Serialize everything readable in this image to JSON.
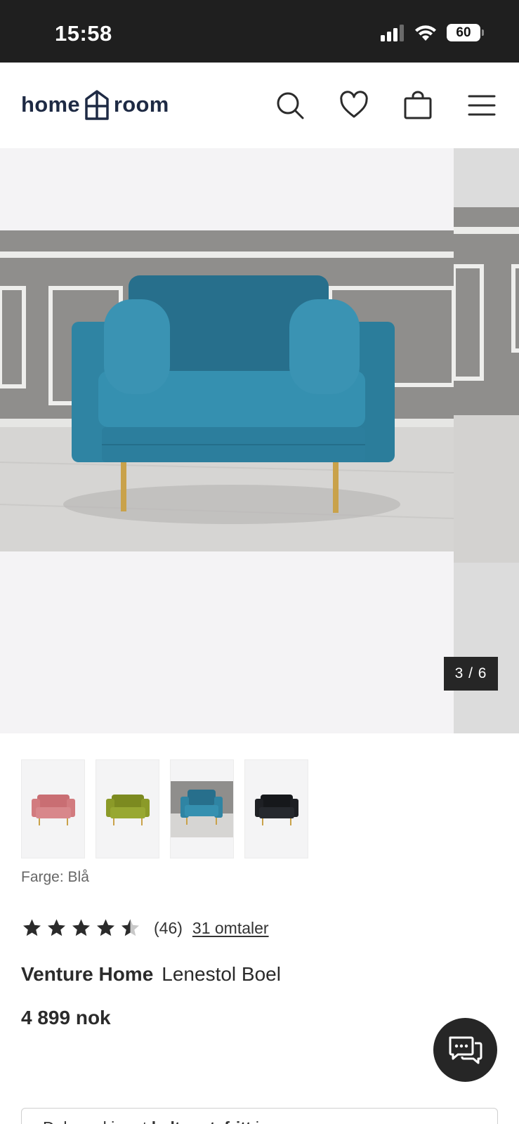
{
  "status_bar": {
    "time": "15:58",
    "battery": "60",
    "icons": [
      "signal-icon",
      "wifi-icon",
      "battery-icon"
    ]
  },
  "header": {
    "logo_left": "home",
    "logo_right": "room",
    "icons": [
      "search-icon",
      "heart-icon",
      "bag-icon",
      "menu-icon"
    ]
  },
  "gallery": {
    "counter": "3 / 6",
    "colors": {
      "chair": "#2f84a3",
      "wall": "#8c8c8a",
      "floor": "#d7d6d4",
      "legs": "#c9a24a"
    }
  },
  "thumbnails": [
    {
      "color": "#d27b7f",
      "icon": "armchair-pink"
    },
    {
      "color": "#8b9a28",
      "icon": "armchair-green"
    },
    {
      "color": "#2f84a3",
      "icon": "armchair-blue",
      "selected": true
    },
    {
      "color": "#1e2024",
      "icon": "armchair-black"
    }
  ],
  "color_label": "Farge: Blå",
  "rating": {
    "value": 4.5,
    "count": "(46)",
    "reviews_link": "31 omtaler"
  },
  "product": {
    "brand": "Venture Home",
    "name": "Lenestol Boel",
    "price": "4 899 nok"
  },
  "promo": {
    "text_start": "Del opp kjøpet ",
    "text_bold": "helt rentefritt",
    "text_end": " i"
  },
  "chat": {
    "icon": "chat-icon"
  }
}
